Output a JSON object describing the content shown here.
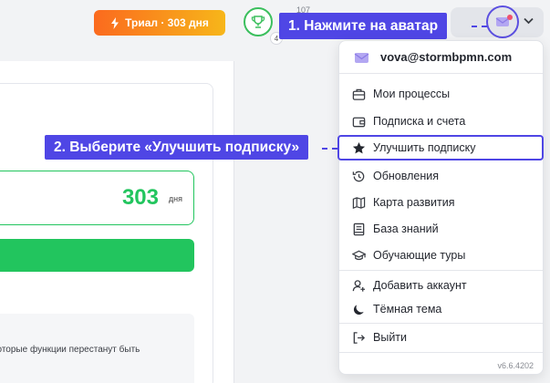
{
  "header": {
    "trial_badge": "Триал · 303 дня",
    "trophy_count": "4",
    "top_number": "107"
  },
  "background": {
    "days_value": "303",
    "days_unit": "дня",
    "note_text": "которые функции перестанут быть"
  },
  "callouts": {
    "step1": "1. Нажмите на аватар",
    "step2": "2. Выберите «Улучшить подписку»"
  },
  "menu": {
    "email": "vova@stormbpmn.com",
    "items": [
      {
        "label": "Мои процессы",
        "icon": "briefcase-icon"
      },
      {
        "label": "Подписка и счета",
        "icon": "wallet-icon"
      },
      {
        "label": "Улучшить подписку",
        "icon": "star-icon"
      },
      {
        "label": "Обновления",
        "icon": "history-icon"
      },
      {
        "label": "Карта развития",
        "icon": "map-icon"
      },
      {
        "label": "База знаний",
        "icon": "book-icon"
      },
      {
        "label": "Обучающие туры",
        "icon": "graduation-cap-icon"
      },
      {
        "label": "Добавить аккаунт",
        "icon": "add-user-icon"
      },
      {
        "label": "Тёмная тема",
        "icon": "moon-icon"
      },
      {
        "label": "Выйти",
        "icon": "logout-icon"
      }
    ],
    "version": "v6.6.4202"
  },
  "colors": {
    "accent": "#4f46e5",
    "green": "#22c55e",
    "trial_start": "#fb6a1e",
    "trial_end": "#f7b61a"
  }
}
